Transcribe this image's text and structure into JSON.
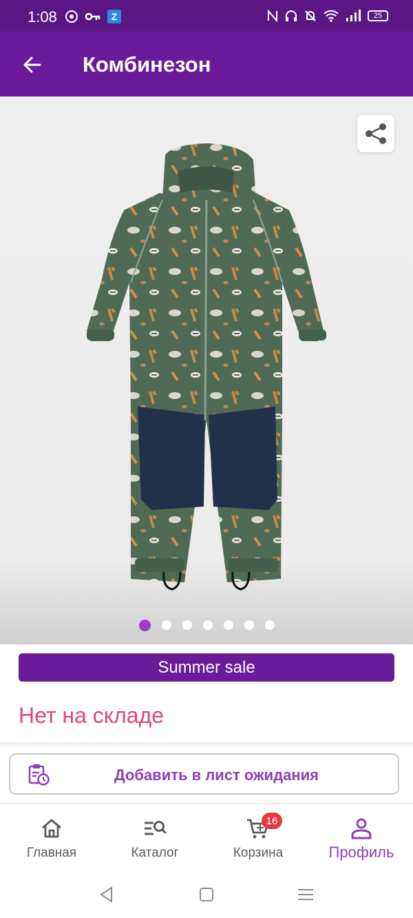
{
  "status_bar": {
    "time": "1:08",
    "battery": "25",
    "left_icons": [
      "media-icon",
      "key-icon",
      "z-app-icon"
    ],
    "z_label": "Z",
    "right_icons": [
      "nfc-icon",
      "headset-icon",
      "mute-icon",
      "wifi-icon",
      "signal-icon",
      "battery-icon"
    ]
  },
  "app_bar": {
    "title": "Комбинезон",
    "back_icon": "arrow-left-icon"
  },
  "product": {
    "image_alt": "Детский комбинезон с принтом животных",
    "share_icon": "share-icon",
    "carousel": {
      "count": 7,
      "active_index": 0
    },
    "sale_label": "Summer sale",
    "stock_status": "Нет на складе"
  },
  "waitlist_button": {
    "label": "Добавить в лист ожидания",
    "icon": "clipboard-clock-icon"
  },
  "bottom_nav": {
    "items": [
      {
        "label": "Главная",
        "icon": "home-icon"
      },
      {
        "label": "Каталог",
        "icon": "catalog-search-icon"
      },
      {
        "label": "Корзина",
        "icon": "cart-icon",
        "badge": "16"
      },
      {
        "label": "Профиль",
        "icon": "profile-icon",
        "active": true
      }
    ]
  },
  "system_nav": {
    "buttons": [
      "back-triangle-icon",
      "home-square-icon",
      "menu-icon"
    ]
  },
  "colors": {
    "status_bar": "#5b1685",
    "app_bar": "#6a1b9a",
    "accent": "#8e3fb7",
    "stock_text": "#e0457b",
    "badge": "#e53946",
    "garment_green": "#4f6a55",
    "garment_navy": "#23304a"
  }
}
